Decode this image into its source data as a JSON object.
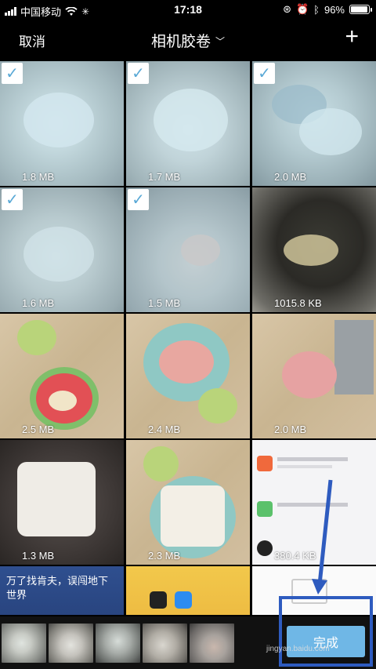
{
  "status_bar": {
    "carrier": "中国移动",
    "time": "17:18",
    "battery": "96%",
    "battery_level": 0.96
  },
  "nav": {
    "cancel_label": "取消",
    "title": "相机胶卷",
    "add_label": "+"
  },
  "photos": [
    {
      "size": "1.8 MB",
      "selected": true
    },
    {
      "size": "1.7 MB",
      "selected": true
    },
    {
      "size": "2.0 MB",
      "selected": true
    },
    {
      "size": "1.6 MB",
      "selected": true
    },
    {
      "size": "1.5 MB",
      "selected": true
    },
    {
      "size": "1015.8 KB",
      "selected": false
    },
    {
      "size": "2.5 MB",
      "selected": false
    },
    {
      "size": "2.4 MB",
      "selected": false
    },
    {
      "size": "2.0 MB",
      "selected": false
    },
    {
      "size": "1.3 MB",
      "selected": false
    },
    {
      "size": "2.3 MB",
      "selected": false
    },
    {
      "size": "380.4 KB",
      "selected": false
    }
  ],
  "partial_row": {
    "text_line1": "万了找肯夫，误闯地下",
    "text_line2": "世界"
  },
  "bottom_bar": {
    "complete_label": "完成"
  },
  "watermark": "jingyan.baidu.com",
  "colors": {
    "accent": "#6fb7e6",
    "check": "#5aa9d6",
    "annotation": "#2e5bbf"
  }
}
